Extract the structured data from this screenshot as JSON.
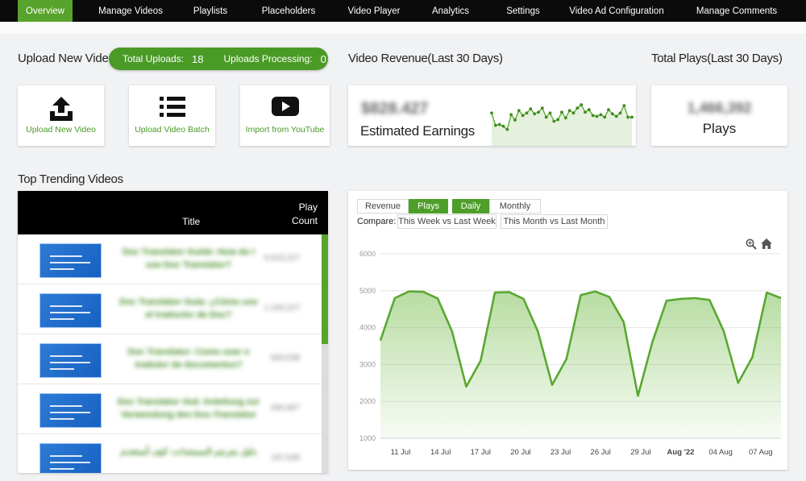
{
  "nav": {
    "tabs": [
      {
        "label": "Overview",
        "active": true
      },
      {
        "label": "Manage Videos"
      },
      {
        "label": "Playlists"
      },
      {
        "label": "Placeholders"
      },
      {
        "label": "Video Player"
      },
      {
        "label": "Analytics"
      },
      {
        "label": "Settings"
      },
      {
        "label": "Video Ad Configuration"
      },
      {
        "label": "Manage Comments"
      }
    ]
  },
  "upload": {
    "title": "Upload New Videos",
    "total_uploads_label": "Total Uploads:",
    "total_uploads_value": "18",
    "processing_label": "Uploads Processing:",
    "processing_value": "0",
    "tiles": [
      {
        "label": "Upload New Video",
        "icon": "upload-icon"
      },
      {
        "label": "Upload Video Batch",
        "icon": "list-icon"
      },
      {
        "label": "Import from YouTube",
        "icon": "youtube-icon"
      }
    ]
  },
  "revenue": {
    "title": "Video Revenue(Last 30 Days)",
    "amount": "$828.427",
    "label": "Estimated Earnings",
    "sparkline": [
      0.72,
      0.42,
      0.44,
      0.4,
      0.32,
      0.68,
      0.55,
      0.78,
      0.66,
      0.72,
      0.82,
      0.7,
      0.74,
      0.84,
      0.62,
      0.72,
      0.52,
      0.56,
      0.74,
      0.6,
      0.78,
      0.72,
      0.84,
      0.92,
      0.74,
      0.8,
      0.66,
      0.64,
      0.68,
      0.62,
      0.8,
      0.7,
      0.64,
      0.72,
      0.9,
      0.62,
      0.62
    ]
  },
  "plays": {
    "title": "Total Plays(Last 30 Days)",
    "amount": "1,466,392",
    "label": "Plays"
  },
  "trending": {
    "title": "Top Trending Videos",
    "col_title": "Title",
    "col_count": "Play Count",
    "rows": [
      {
        "title": "Doc Translator Guide: How do I use Doc Translator?",
        "count": "6,615,227"
      },
      {
        "title": "Doc Translator Guía: ¿Cómo uso el traductor de Doc?",
        "count": "1,105,227"
      },
      {
        "title": "Doc Translator: Como usar o tradutor de documentos?",
        "count": "660,538"
      },
      {
        "title": "Doc Translator Vod: Anleitung zur Verwendung des Doc-Translator",
        "count": "265,657"
      },
      {
        "title": "دليل مترجم المستندات: كيف أستخدم",
        "count": "197,538"
      }
    ]
  },
  "chart": {
    "metric_buttons": [
      "Revenue",
      "Plays"
    ],
    "period_buttons": [
      "Daily",
      "Monthly"
    ],
    "compare_label": "Compare:",
    "compare_buttons": [
      "This Week vs Last Week",
      "This Month vs Last Month"
    ],
    "zoom_icon": "zoom-icon",
    "home_icon": "home-icon",
    "accent": "#5aa832"
  },
  "chart_data": {
    "type": "area",
    "y_ticks": [
      "6000",
      "5000",
      "4000",
      "3000",
      "2000",
      "1000"
    ],
    "x_ticks": [
      {
        "label": "11 Jul",
        "bold": false
      },
      {
        "label": "14 Jul",
        "bold": false
      },
      {
        "label": "17 Jul",
        "bold": false
      },
      {
        "label": "20 Jul",
        "bold": false
      },
      {
        "label": "23 Jul",
        "bold": false
      },
      {
        "label": "26 Jul",
        "bold": false
      },
      {
        "label": "29 Jul",
        "bold": false
      },
      {
        "label": "Aug '22",
        "bold": true
      },
      {
        "label": "04 Aug",
        "bold": false
      },
      {
        "label": "07 Aug",
        "bold": false
      }
    ],
    "ylim": [
      1000,
      6000
    ],
    "grid": true,
    "values": [
      3650,
      4800,
      4980,
      4970,
      4790,
      3900,
      2400,
      3100,
      4950,
      4960,
      4780,
      3900,
      2450,
      3150,
      4880,
      4980,
      4830,
      4150,
      2150,
      3600,
      4730,
      4780,
      4800,
      4750,
      3900,
      2500,
      3200,
      4950,
      4800
    ]
  }
}
